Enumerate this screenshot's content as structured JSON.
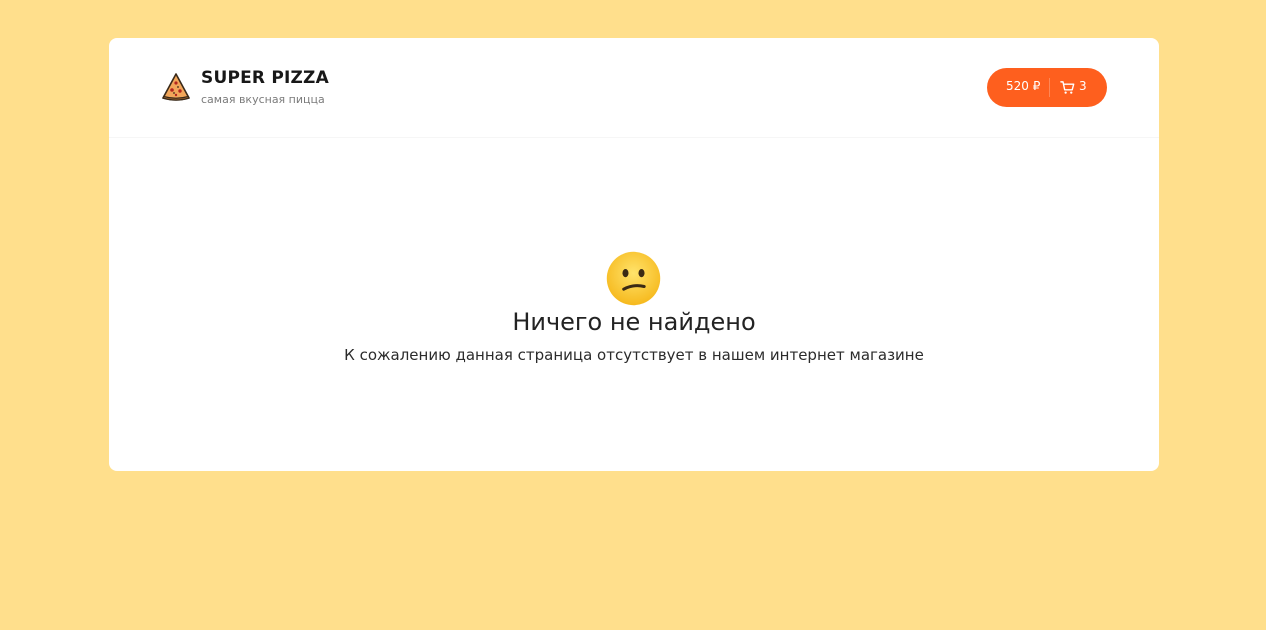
{
  "header": {
    "logo_icon": "pizza-slice-icon",
    "title": "SUPER PIZZA",
    "subtitle": "самая вкусная пицца"
  },
  "cart": {
    "price": "520 ₽",
    "icon": "cart-icon",
    "count": "3",
    "color": "#fe5f1e"
  },
  "empty": {
    "emoji": "confused-face-icon",
    "title": "Ничего не найдено",
    "text": "К сожалению данная страница отсутствует в нашем интернет магазине"
  },
  "colors": {
    "background": "#ffdf8c",
    "card": "#ffffff",
    "accent": "#fe5f1e"
  }
}
